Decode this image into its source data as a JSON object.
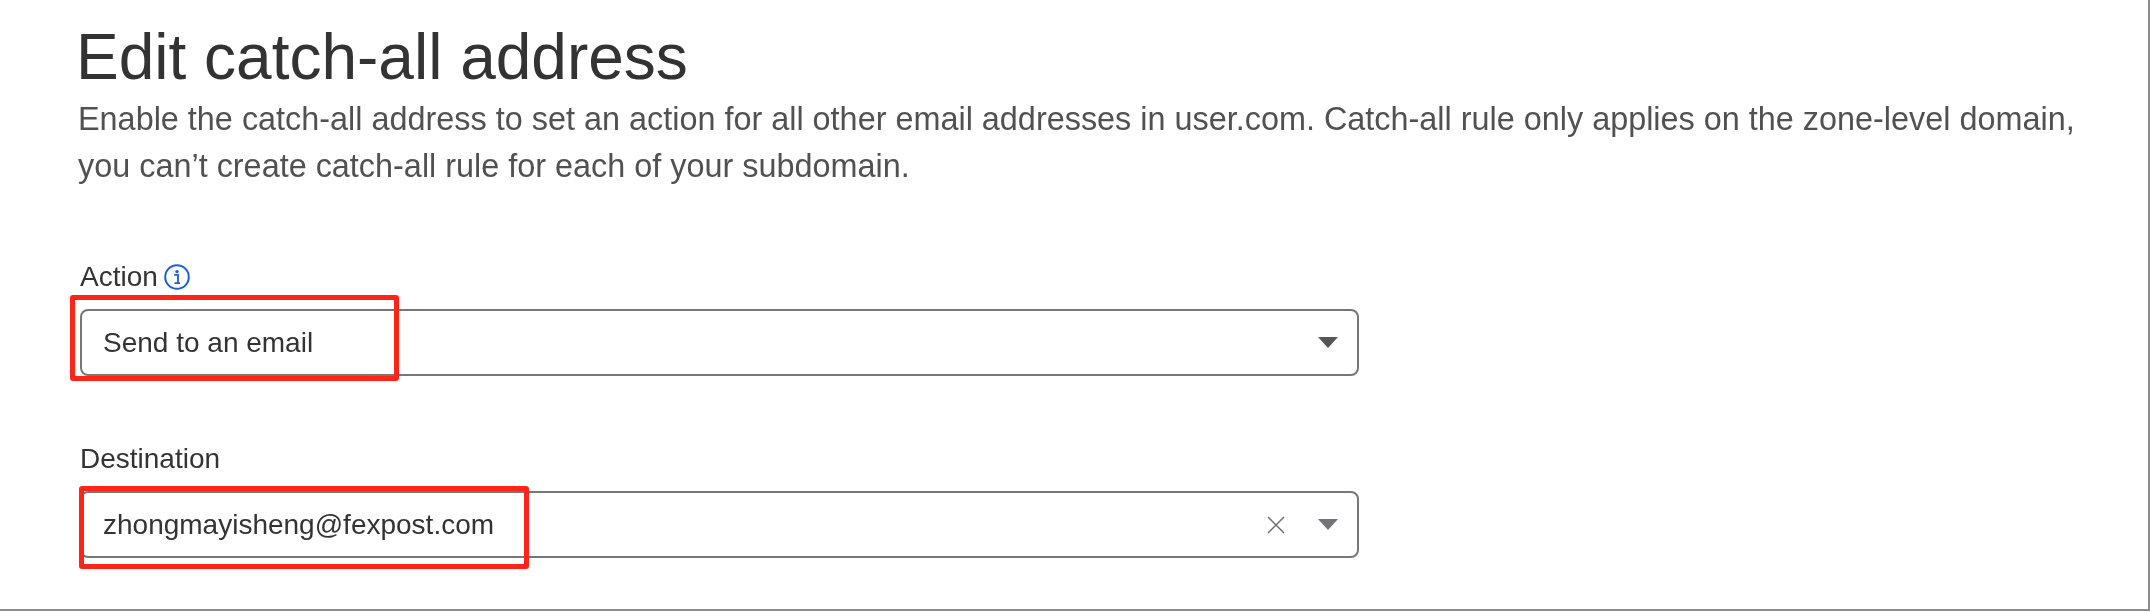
{
  "title": "Edit catch-all address",
  "description": "Enable the catch-all address to set an action for all other email addresses in user.com. Catch-all rule only applies on the zone-level domain, you can’t create catch-all rule for each of your subdomain.",
  "fields": [
    {
      "kind": "select",
      "label": "Action",
      "info": true,
      "value": "Send to an email",
      "clearable": false,
      "highlighted": true
    },
    {
      "kind": "combobox",
      "label": "Destination",
      "info": false,
      "value": "zhongmayisheng@fexpost.com",
      "clearable": true,
      "highlighted": true
    }
  ]
}
